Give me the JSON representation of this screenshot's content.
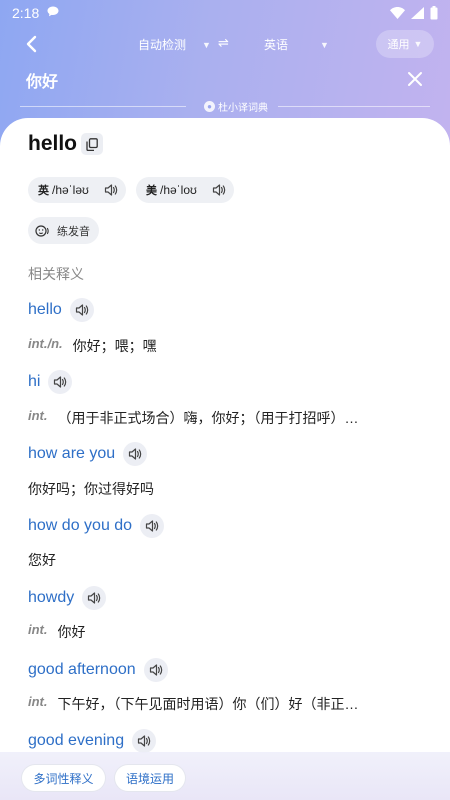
{
  "status_bar": {
    "time": "2:18",
    "icons": [
      "chat-icon",
      "wifi-icon",
      "signal-icon",
      "battery-icon"
    ]
  },
  "topbar": {
    "source_language": "自动检测",
    "target_language": "英语",
    "mode_button": "通用"
  },
  "query": {
    "text": "你好"
  },
  "brand": {
    "label": "杜小译词典"
  },
  "word": {
    "headword": "hello",
    "pronunciations": [
      {
        "region": "英",
        "ipa": "/həˈləʊ"
      },
      {
        "region": "美",
        "ipa": "/həˈloʊ"
      }
    ],
    "practice_label": "练发音"
  },
  "related": {
    "title": "相关释义",
    "entries": [
      {
        "word": "hello",
        "pos": "int./n.",
        "definition": "你好；喂；嘿"
      },
      {
        "word": "hi",
        "pos": "int.",
        "definition": "（用于非正式场合）嗨，你好；（用于打招呼）…"
      },
      {
        "word": "how are you",
        "pos": "",
        "definition": "你好吗；你过得好吗"
      },
      {
        "word": "how do you do",
        "pos": "",
        "definition": "您好"
      },
      {
        "word": "howdy",
        "pos": "int.",
        "definition": "你好"
      },
      {
        "word": "good afternoon",
        "pos": "int.",
        "definition": "下午好，（下午见面时用语）你（们）好（非正…"
      },
      {
        "word": "good evening",
        "pos": "",
        "definition": ""
      }
    ]
  },
  "bottom_tabs": [
    "多词性释义",
    "语境运用"
  ],
  "colors": {
    "accent": "#2e6fc7",
    "header_gradient_start": "#8ea7f2",
    "header_gradient_end": "#c2b3ef"
  }
}
